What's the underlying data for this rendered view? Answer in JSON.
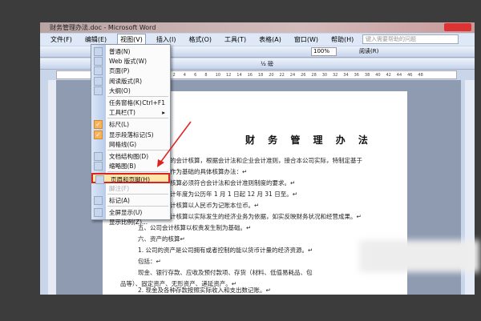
{
  "window": {
    "title": "财务管理办法.doc - Microsoft Word"
  },
  "menubar": [
    "文件(F)",
    "编辑(E)",
    "视图(V)",
    "插入(I)",
    "格式(O)",
    "工具(T)",
    "表格(A)",
    "窗口(W)",
    "帮助(H)"
  ],
  "help_placeholder": "键入需要帮助的问题",
  "toolbar": {
    "zoom": "100%",
    "read": "阅读(R)",
    "font_size": "½ 磅"
  },
  "ruler_ticks": [
    "8",
    "6",
    "4",
    "2",
    "",
    "2",
    "4",
    "6",
    "8",
    "10",
    "12",
    "14",
    "16",
    "18",
    "20",
    "22",
    "24",
    "26",
    "28",
    "30",
    "32",
    "34",
    "36",
    "38",
    "40",
    "42",
    "44",
    "46",
    "48"
  ],
  "view_menu": [
    {
      "label": "普通(N)",
      "icon": "normal-view-icon"
    },
    {
      "label": "Web 版式(W)",
      "icon": "web-layout-icon"
    },
    {
      "label": "页面(P)",
      "icon": "print-layout-icon"
    },
    {
      "label": "阅读版式(R)",
      "icon": "reading-layout-icon"
    },
    {
      "label": "大纲(O)",
      "icon": "outline-icon"
    },
    {
      "label": "任务窗格(K)",
      "shortcut": "Ctrl+F1"
    },
    {
      "label": "工具栏(T)",
      "submenu": "▸"
    },
    {
      "label": "标尺(L)",
      "checked": true
    },
    {
      "label": "显示段落标记(S)",
      "checked": true
    },
    {
      "label": "网格线(G)"
    },
    {
      "label": "文档结构图(D)",
      "icon": "document-map-icon"
    },
    {
      "label": "缩略图(B)",
      "icon": "thumbnails-icon"
    },
    {
      "label": "页眉和页脚(H)",
      "icon": "header-footer-icon",
      "highlighted": true
    },
    {
      "label": "脚注(F)",
      "disabled": true
    },
    {
      "label": "标记(A)",
      "icon": "markup-icon"
    },
    {
      "label": "全屏显示(U)",
      "icon": "full-screen-icon"
    },
    {
      "label": "显示比例(Z)..."
    }
  ],
  "document": {
    "title": "财 务 管 理 办 法",
    "lines": [
      "的会计核算，根据会计法和企业会计准则，接合本公司实际，特制定基于",
      "作为基础的具体核算办法：↵",
      "核算必须符合会计法和会计准则制度的要求。↵",
      "计年度为公历年 1 月 1 日起 12 月 31 日至。↵",
      "计核算以人民币为记账本位币。↵",
      "计核算以实际发生的经济业务为依据，如实反映财务状况和经营成果。↵",
      "五、公司会计核算以权责发生制为基础。↵",
      "六、资产的核算↵",
      "1. 公司的资产是公司拥有或者控制的能以货币计量的经济资源。↵",
      "包括：↵",
      "现金、银行存款、应收及预付款项、存货（材料、低值易耗品、包",
      "品等）、固定资产、无形资产、递延资产。↵",
      "2. 现金及各种存款按照实际收入和支出数记账。↵"
    ]
  },
  "colors": {
    "highlight_border": "#dd2222",
    "arrow": "#dd2222",
    "check": "#f7b25a"
  }
}
